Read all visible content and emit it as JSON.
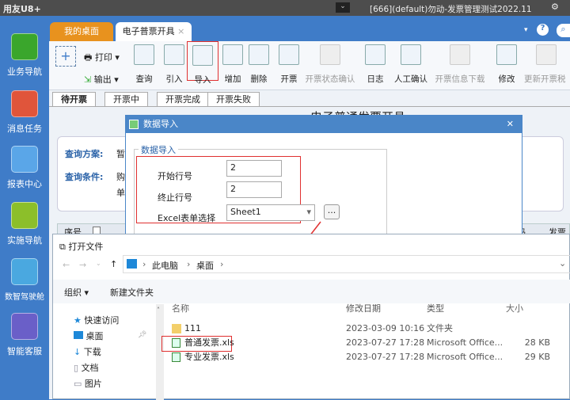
{
  "app": {
    "name": "用友U8+",
    "title": "[666](default)勿动-发票管理测试2022.11"
  },
  "sidebar": {
    "items": [
      {
        "label": "业务导航",
        "color": "#3aa62c"
      },
      {
        "label": "消息任务",
        "color": "#e0553b"
      },
      {
        "label": "报表中心",
        "color": "#5aa6e8"
      },
      {
        "label": "实施导航",
        "color": "#8cbf2a"
      },
      {
        "label": "数智驾驶舱",
        "color": "#4aa8e0"
      },
      {
        "label": "智能客服",
        "color": "#6a5fc8"
      }
    ]
  },
  "tabs": [
    {
      "label": "我的桌面"
    },
    {
      "label": "电子普票开具",
      "close": "×"
    }
  ],
  "toolbar": {
    "print": "打印",
    "export": "输出",
    "buttons": [
      {
        "label": "查询"
      },
      {
        "label": "引入"
      },
      {
        "label": "导入"
      },
      {
        "label": "增加"
      },
      {
        "label": "删除"
      },
      {
        "label": "开票"
      },
      {
        "label": "开票状态确认"
      },
      {
        "label": "日志"
      },
      {
        "label": "人工确认"
      },
      {
        "label": "开票信息下载"
      },
      {
        "label": "修改"
      },
      {
        "label": "更新开票税"
      }
    ]
  },
  "subtabs": [
    "待开票",
    "开票中",
    "开票完成",
    "开票失败"
  ],
  "page": {
    "title": "电子普通发票开具",
    "scheme_label": "查询方案:",
    "scheme_value": "暂",
    "cond_label": "查询条件:",
    "cond_value": "购",
    "cond_value2": "单",
    "col_index": "序号",
    "col_r1": "码",
    "col_r2": "发票号"
  },
  "import_dialog": {
    "title": "数据导入",
    "group": "数据导入",
    "start_label": "开始行号",
    "start_value": "2",
    "end_label": "终止行号",
    "end_value": "2",
    "sheet_label": "Excel表单选择",
    "sheet_value": "Sheet1",
    "browse": "..."
  },
  "file_dialog": {
    "title": "打开文件",
    "path": [
      "此电脑",
      "桌面"
    ],
    "organize": "组织 ▾",
    "new_folder": "新建文件夹",
    "side": [
      "快速访问",
      "桌面",
      "下载",
      "文档",
      "图片"
    ],
    "columns": [
      "名称",
      "修改日期",
      "类型",
      "大小"
    ],
    "files": [
      {
        "name": "111",
        "date": "2023-03-09 10:16",
        "type": "文件夹",
        "size": ""
      },
      {
        "name": "普通发票.xls",
        "date": "2023-07-27 17:28",
        "type": "Microsoft Office...",
        "size": "28 KB"
      },
      {
        "name": "专业发票.xls",
        "date": "2023-07-27 17:28",
        "type": "Microsoft Office...",
        "size": "29 KB"
      }
    ]
  },
  "highlight_color": "#e03030"
}
